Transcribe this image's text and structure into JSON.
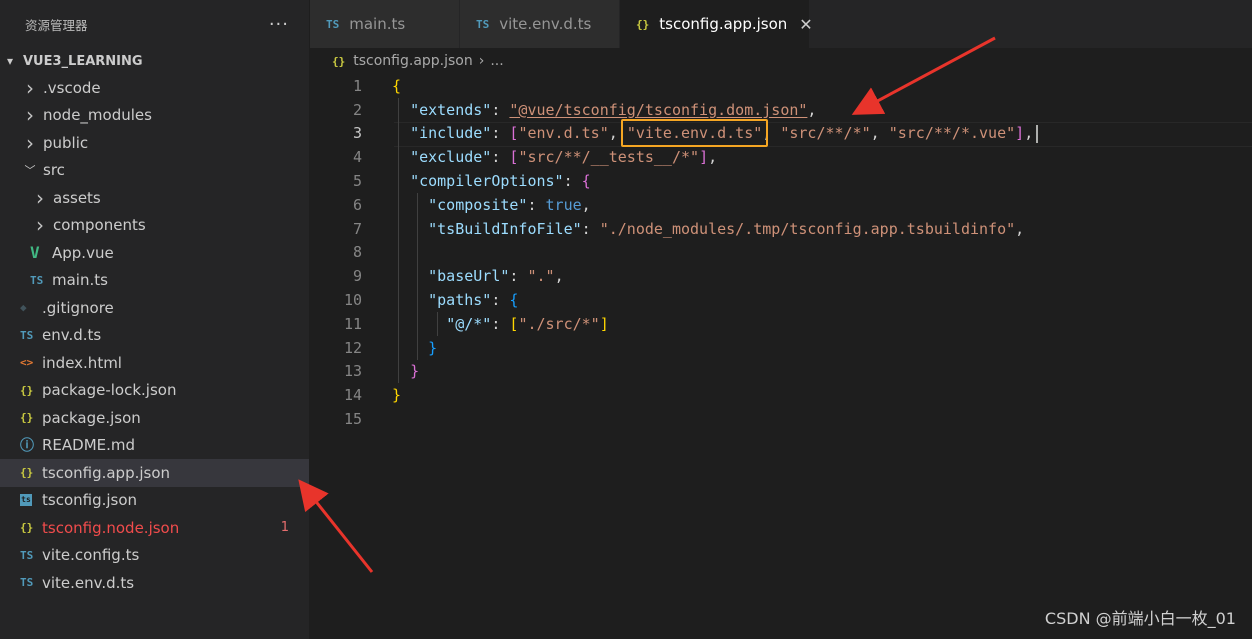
{
  "sidebar": {
    "title": "资源管理器",
    "more_label": "···",
    "root_label": "VUE3_LEARNING",
    "items": [
      {
        "label": ".vscode",
        "type": "folder",
        "icon": "chevron-right-icon",
        "level": 1
      },
      {
        "label": "node_modules",
        "type": "folder",
        "icon": "chevron-right-icon",
        "level": 1
      },
      {
        "label": "public",
        "type": "folder",
        "icon": "chevron-right-icon",
        "level": 1
      },
      {
        "label": "src",
        "type": "folder-open",
        "icon": "chevron-down-icon",
        "level": 1
      },
      {
        "label": "assets",
        "type": "folder",
        "icon": "chevron-right-icon",
        "level": 2
      },
      {
        "label": "components",
        "type": "folder",
        "icon": "chevron-right-icon",
        "level": 2
      },
      {
        "label": "App.vue",
        "type": "file",
        "icon": "vue-icon",
        "glyph": "V",
        "level": 2
      },
      {
        "label": "main.ts",
        "type": "file",
        "icon": "typescript-icon",
        "glyph": "TS",
        "level": 2
      },
      {
        "label": ".gitignore",
        "type": "file",
        "icon": "git-icon",
        "glyph": "◆",
        "level": 1
      },
      {
        "label": "env.d.ts",
        "type": "file",
        "icon": "typescript-icon",
        "glyph": "TS",
        "level": 1
      },
      {
        "label": "index.html",
        "type": "file",
        "icon": "html-icon",
        "glyph": "<>",
        "level": 1
      },
      {
        "label": "package-lock.json",
        "type": "file",
        "icon": "json-icon",
        "glyph": "{}",
        "level": 1
      },
      {
        "label": "package.json",
        "type": "file",
        "icon": "json-icon",
        "glyph": "{}",
        "level": 1
      },
      {
        "label": "README.md",
        "type": "file",
        "icon": "info-icon",
        "glyph": "ⓘ",
        "level": 1
      },
      {
        "label": "tsconfig.app.json",
        "type": "file",
        "icon": "json-icon",
        "glyph": "{}",
        "level": 1,
        "selected": true
      },
      {
        "label": "tsconfig.json",
        "type": "file",
        "icon": "tsconfig-icon",
        "glyph": "ts",
        "level": 1
      },
      {
        "label": "tsconfig.node.json",
        "type": "file",
        "icon": "json-icon",
        "glyph": "{}",
        "level": 1,
        "error": true,
        "badge": "1"
      },
      {
        "label": "vite.config.ts",
        "type": "file",
        "icon": "typescript-icon",
        "glyph": "TS",
        "level": 1
      },
      {
        "label": "vite.env.d.ts",
        "type": "file",
        "icon": "typescript-icon",
        "glyph": "TS",
        "level": 1
      }
    ]
  },
  "tabs": [
    {
      "label": "main.ts",
      "glyph": "TS",
      "icon": "typescript-icon",
      "active": false
    },
    {
      "label": "vite.env.d.ts",
      "glyph": "TS",
      "icon": "typescript-icon",
      "active": false
    },
    {
      "label": "tsconfig.app.json",
      "glyph": "{}",
      "icon": "json-icon",
      "active": true,
      "close": "✕"
    }
  ],
  "breadcrumb": {
    "glyph": "{}",
    "file": "tsconfig.app.json",
    "sep": "›",
    "rest": "..."
  },
  "editor": {
    "lines": [
      {
        "n": "1",
        "tokens": [
          {
            "t": "{",
            "c": "b1"
          }
        ]
      },
      {
        "n": "2",
        "tokens": [
          {
            "t": "  "
          },
          {
            "t": "\"extends\"",
            "c": "k"
          },
          {
            "t": ": "
          },
          {
            "t": "\"@vue/tsconfig/tsconfig.dom.json\"",
            "c": "s u"
          },
          {
            "t": ","
          }
        ]
      },
      {
        "n": "3",
        "tokens": [
          {
            "t": "  "
          },
          {
            "t": "\"include\"",
            "c": "k"
          },
          {
            "t": ": "
          },
          {
            "t": "[",
            "c": "b2"
          },
          {
            "t": "\"env.d.ts\"",
            "c": "s"
          },
          {
            "t": ", "
          },
          {
            "t": "\"vite.env.d.ts\"",
            "c": "s",
            "mark": true
          },
          {
            "t": ", "
          },
          {
            "t": "\"src/**/*\"",
            "c": "s"
          },
          {
            "t": ", "
          },
          {
            "t": "\"src/**/*.vue\"",
            "c": "s"
          },
          {
            "t": "]",
            "c": "b2"
          },
          {
            "t": ","
          }
        ]
      },
      {
        "n": "4",
        "tokens": [
          {
            "t": "  "
          },
          {
            "t": "\"exclude\"",
            "c": "k"
          },
          {
            "t": ": "
          },
          {
            "t": "[",
            "c": "b2"
          },
          {
            "t": "\"src/**/__tests__/*\"",
            "c": "s"
          },
          {
            "t": "]",
            "c": "b2"
          },
          {
            "t": ","
          }
        ]
      },
      {
        "n": "5",
        "tokens": [
          {
            "t": "  "
          },
          {
            "t": "\"compilerOptions\"",
            "c": "k"
          },
          {
            "t": ": "
          },
          {
            "t": "{",
            "c": "b2"
          }
        ]
      },
      {
        "n": "6",
        "tokens": [
          {
            "t": "    "
          },
          {
            "t": "\"composite\"",
            "c": "k"
          },
          {
            "t": ": "
          },
          {
            "t": "true",
            "c": "kw"
          },
          {
            "t": ","
          }
        ]
      },
      {
        "n": "7",
        "tokens": [
          {
            "t": "    "
          },
          {
            "t": "\"tsBuildInfoFile\"",
            "c": "k"
          },
          {
            "t": ": "
          },
          {
            "t": "\"./node_modules/.tmp/tsconfig.app.tsbuildinfo\"",
            "c": "s"
          },
          {
            "t": ","
          }
        ]
      },
      {
        "n": "8",
        "tokens": []
      },
      {
        "n": "9",
        "tokens": [
          {
            "t": "    "
          },
          {
            "t": "\"baseUrl\"",
            "c": "k"
          },
          {
            "t": ": "
          },
          {
            "t": "\".\"",
            "c": "s"
          },
          {
            "t": ","
          }
        ]
      },
      {
        "n": "10",
        "tokens": [
          {
            "t": "    "
          },
          {
            "t": "\"paths\"",
            "c": "k"
          },
          {
            "t": ": "
          },
          {
            "t": "{",
            "c": "b3"
          }
        ]
      },
      {
        "n": "11",
        "tokens": [
          {
            "t": "      "
          },
          {
            "t": "\"@/*\"",
            "c": "k"
          },
          {
            "t": ": "
          },
          {
            "t": "[",
            "c": "b1"
          },
          {
            "t": "\"./src/*\"",
            "c": "s"
          },
          {
            "t": "]",
            "c": "b1"
          }
        ]
      },
      {
        "n": "12",
        "tokens": [
          {
            "t": "    "
          },
          {
            "t": "}",
            "c": "b3"
          }
        ]
      },
      {
        "n": "13",
        "tokens": [
          {
            "t": "  "
          },
          {
            "t": "}",
            "c": "b2"
          }
        ]
      },
      {
        "n": "14",
        "tokens": [
          {
            "t": "}",
            "c": "b1"
          }
        ]
      },
      {
        "n": "15",
        "tokens": []
      }
    ],
    "current_line": "3"
  },
  "watermark": "CSDN @前端小白一枚_01",
  "colors": {
    "annotation_box": "#f5a623",
    "annotation_arrow": "#e8342b"
  }
}
